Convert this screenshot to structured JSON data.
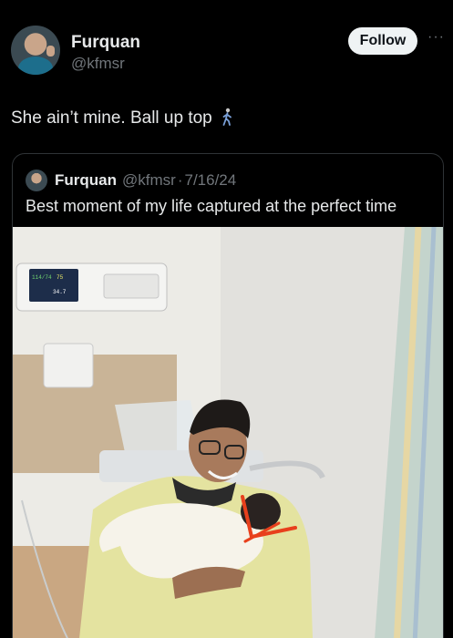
{
  "author": {
    "display_name": "Furquan",
    "handle": "@kfmsr",
    "follow_label": "Follow",
    "more_icon": "more-horizontal-icon"
  },
  "post": {
    "text": "She ain’t mine. Ball up top",
    "emoji_icon": "person-walking-icon"
  },
  "quote": {
    "display_name": "Furquan",
    "handle": "@kfmsr",
    "separator": "·",
    "date": "7/16/24",
    "text": "Best moment of my life captured at the perfect time",
    "monitor": {
      "reading_1": "114/74",
      "reading_2": "75",
      "reading_3": "34.7"
    }
  },
  "colors": {
    "background": "#000000",
    "text_primary": "#e7e9ea",
    "text_secondary": "#71767b",
    "border": "#2f3336",
    "follow_bg": "#eff3f4",
    "annotation": "#e8401c"
  }
}
